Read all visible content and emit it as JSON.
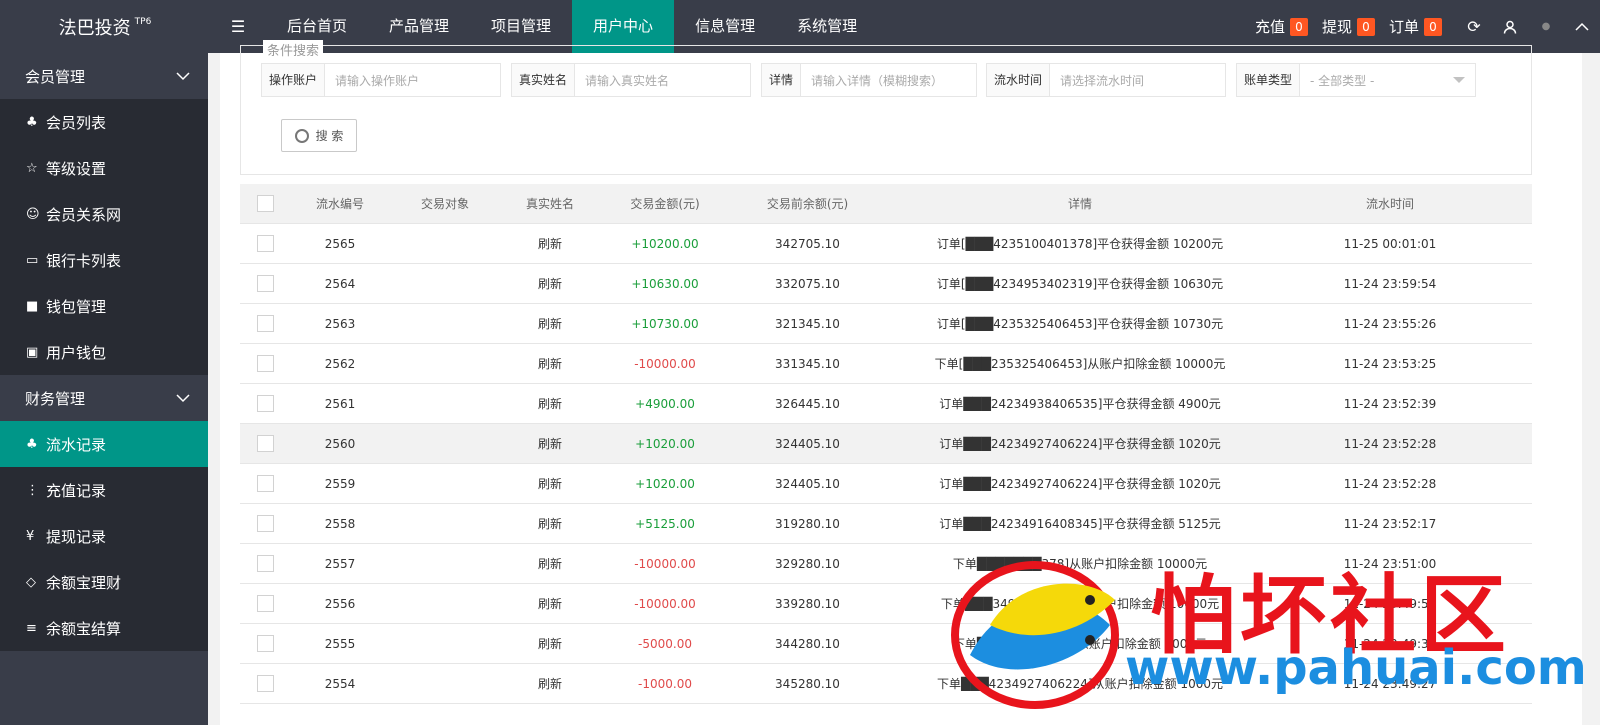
{
  "header": {
    "logo": "法巴投资",
    "logo_sup": "TP6",
    "menu_icon": "menu-icon",
    "nav": [
      "后台首页",
      "产品管理",
      "项目管理",
      "用户中心",
      "信息管理",
      "系统管理"
    ],
    "active_nav": "用户中心",
    "recharge_label": "充值",
    "recharge_count": "0",
    "withdraw_label": "提现",
    "withdraw_count": "0",
    "order_label": "订单",
    "order_count": "0"
  },
  "sidebar": {
    "group1": "会员管理",
    "items1": [
      "会员列表",
      "等级设置",
      "会员关系网",
      "银行卡列表",
      "钱包管理",
      "用户钱包"
    ],
    "group2": "财务管理",
    "items2": [
      "流水记录",
      "充值记录",
      "提现记录",
      "余额宝理财",
      "余额宝结算"
    ],
    "active_item": "流水记录"
  },
  "search": {
    "legend": "条件搜索",
    "account_label": "操作账户",
    "account_placeholder": "请输入操作账户",
    "name_label": "真实姓名",
    "name_placeholder": "请输入真实姓名",
    "detail_label": "详情",
    "detail_placeholder": "请输入详情（模糊搜索）",
    "time_label": "流水时间",
    "time_placeholder": "请选择流水时间",
    "type_label": "账单类型",
    "type_value": "- 全部类型 -",
    "search_button": "搜 索"
  },
  "table": {
    "headers": [
      "流水编号",
      "交易对象",
      "真实姓名",
      "交易金额(元)",
      "交易前余额(元)",
      "详情",
      "流水时间"
    ],
    "rows": [
      {
        "id": "2565",
        "target": "",
        "name": "刷新",
        "amount": "+10200.00",
        "sign": "pos",
        "before": "342705.10",
        "detail": "订单[███4235100401378]平仓获得金额 10200元",
        "time": "11-25 00:01:01"
      },
      {
        "id": "2564",
        "target": "",
        "name": "刷新",
        "amount": "+10630.00",
        "sign": "pos",
        "before": "332075.10",
        "detail": "订单[███4234953402319]平仓获得金额 10630元",
        "time": "11-24 23:59:54"
      },
      {
        "id": "2563",
        "target": "",
        "name": "刷新",
        "amount": "+10730.00",
        "sign": "pos",
        "before": "321345.10",
        "detail": "订单[███4235325406453]平仓获得金额 10730元",
        "time": "11-24 23:55:26"
      },
      {
        "id": "2562",
        "target": "",
        "name": "刷新",
        "amount": "-10000.00",
        "sign": "neg",
        "before": "331345.10",
        "detail": "下单[███235325406453]从账户扣除金额 10000元",
        "time": "11-24 23:53:25"
      },
      {
        "id": "2561",
        "target": "",
        "name": "刷新",
        "amount": "+4900.00",
        "sign": "pos",
        "before": "326445.10",
        "detail": "订单███24234938406535]平仓获得金额 4900元",
        "time": "11-24 23:52:39"
      },
      {
        "id": "2560",
        "target": "",
        "name": "刷新",
        "amount": "+1020.00",
        "sign": "pos",
        "before": "324405.10",
        "detail": "订单███24234927406224]平仓获得金额 1020元",
        "time": "11-24 23:52:28"
      },
      {
        "id": "2559",
        "target": "",
        "name": "刷新",
        "amount": "+1020.00",
        "sign": "pos",
        "before": "324405.10",
        "detail": "订单███24234927406224]平仓获得金额 1020元",
        "time": "11-24 23:52:28"
      },
      {
        "id": "2558",
        "target": "",
        "name": "刷新",
        "amount": "+5125.00",
        "sign": "pos",
        "before": "319280.10",
        "detail": "订单███24234916408345]平仓获得金额 5125元",
        "time": "11-24 23:52:17"
      },
      {
        "id": "2557",
        "target": "",
        "name": "刷新",
        "amount": "-10000.00",
        "sign": "neg",
        "before": "329280.10",
        "detail": "下单███████378]从账户扣除金额 10000元",
        "time": "11-24 23:51:00"
      },
      {
        "id": "2556",
        "target": "",
        "name": "刷新",
        "amount": "-10000.00",
        "sign": "neg",
        "before": "339280.10",
        "detail": "下单███34953402319]从账户扣除金额 10000元",
        "time": "11-24 23:49:53"
      },
      {
        "id": "2555",
        "target": "",
        "name": "刷新",
        "amount": "-5000.00",
        "sign": "neg",
        "before": "344280.10",
        "detail": "下单███████6535]从账户扣除金额 5000元",
        "time": "11-24 23:49:38"
      },
      {
        "id": "2554",
        "target": "",
        "name": "刷新",
        "amount": "-1000.00",
        "sign": "neg",
        "before": "345280.10",
        "detail": "下单███4234927406224]从账户扣除金额 1000元",
        "time": "11-24 23:49:27"
      }
    ],
    "highlight_row": "2560"
  },
  "watermark": {
    "text": "怕坏社区",
    "url": "www.pahuai.com"
  },
  "colors": {
    "header_bg": "#393d49",
    "accent": "#009688",
    "badge": "#ff5722",
    "positive": "#1a9e3a",
    "negative": "#e04a4a",
    "watermark_red": "#e8141c",
    "watermark_blue": "#1c8ee0"
  }
}
